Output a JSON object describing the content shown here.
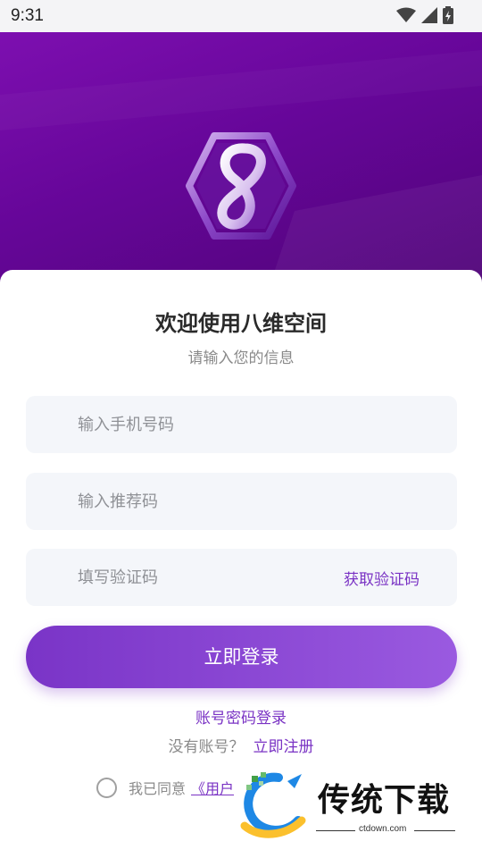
{
  "status_bar": {
    "time": "9:31"
  },
  "header": {
    "logo_icon": "hexagon-eight-logo-icon"
  },
  "card": {
    "title": "欢迎使用八维空间",
    "subtitle": "请输入您的信息"
  },
  "form": {
    "phone_placeholder": "输入手机号码",
    "referral_placeholder": "输入推荐码",
    "code_placeholder": "填写验证码",
    "get_code_label": "获取验证码",
    "login_label": "立即登录"
  },
  "links": {
    "password_login": "账号密码登录",
    "no_account": "没有账号？",
    "register": "立即注册"
  },
  "agreement": {
    "prefix": "我已同意",
    "link": "《用户"
  },
  "watermark": {
    "title": "传统下载",
    "url": "ctdown.com"
  },
  "colors": {
    "banner_start": "#7d0fb0",
    "banner_end": "#4f0477",
    "accent": "#7a33c4",
    "button_start": "#7a34c7",
    "button_end": "#9a5ae0"
  }
}
